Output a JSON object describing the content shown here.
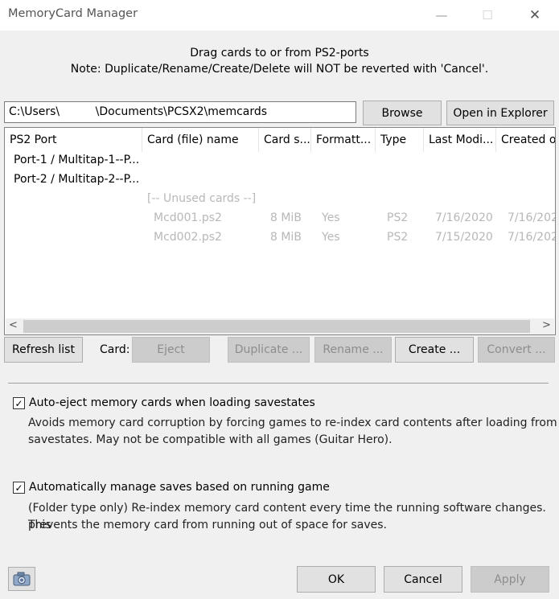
{
  "window": {
    "title": "MemoryCard Manager",
    "controls": {
      "minimize": "—",
      "maximize": "☐",
      "close": "✕"
    }
  },
  "instructions": {
    "line1": "Drag cards to or from PS2-ports",
    "line2": "Note: Duplicate/Rename/Create/Delete will NOT be reverted with 'Cancel'."
  },
  "path": {
    "value": "C:\\Users\\          \\Documents\\PCSX2\\memcards"
  },
  "buttons": {
    "browse": "Browse",
    "open_explorer": "Open in Explorer",
    "refresh": "Refresh list",
    "card_label": "Card:",
    "eject": "Eject",
    "duplicate": "Duplicate ...",
    "rename": "Rename ...",
    "create": "Create ...",
    "convert": "Convert ...",
    "ok": "OK",
    "cancel": "Cancel",
    "apply": "Apply"
  },
  "table": {
    "columns": [
      "PS2 Port",
      "Card (file) name",
      "Card s...",
      "Formatt...",
      "Type",
      "Last Modi...",
      "Created or"
    ],
    "ports": [
      {
        "port": "Port-1 / Multitap-1--P..."
      },
      {
        "port": "Port-2 / Multitap-2--P..."
      }
    ],
    "unused_label": "[-- Unused cards --]",
    "unused": [
      {
        "name": "Mcd001.ps2",
        "size": "8 MiB",
        "formatted": "Yes",
        "type": "PS2",
        "modified": "7/16/2020",
        "created": "7/16/202"
      },
      {
        "name": "Mcd002.ps2",
        "size": "8 MiB",
        "formatted": "Yes",
        "type": "PS2",
        "modified": "7/15/2020",
        "created": "7/16/202"
      }
    ],
    "scroll_left": "<",
    "scroll_right": ">"
  },
  "options": {
    "auto_eject": {
      "checked": true,
      "label": "Auto-eject memory cards when loading savestates",
      "desc1": "Avoids memory card corruption by forcing games to re-index card contents after loading from",
      "desc2": "savestates.  May not be compatible with all games (Guitar Hero)."
    },
    "auto_manage": {
      "checked": true,
      "label": "Automatically manage saves based on running game",
      "desc1": "(Folder type only) Re-index memory card content every time the running software changes. This",
      "desc2": "prevents the memory card from running out of space for saves."
    },
    "check_glyph": "✓"
  },
  "icons": {
    "camera": "camera-icon"
  }
}
